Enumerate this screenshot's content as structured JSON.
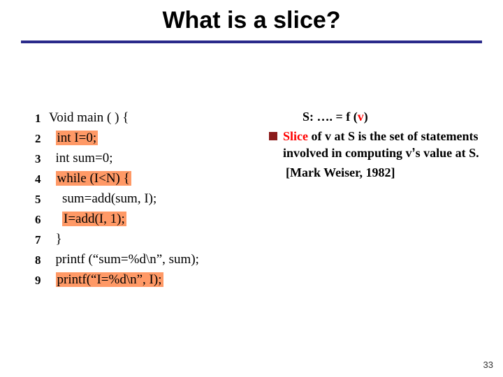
{
  "title": "What is a slice?",
  "code": {
    "lines": [
      {
        "num": "1",
        "indent": 0,
        "text": "Void main ( ) {",
        "hl": false
      },
      {
        "num": "2",
        "indent": 2,
        "text": "int I=0;",
        "hl": true
      },
      {
        "num": "3",
        "indent": 2,
        "text": "int sum=0;",
        "hl": false
      },
      {
        "num": "4",
        "indent": 2,
        "text": "while (I<N) {",
        "hl": true
      },
      {
        "num": "5",
        "indent": 4,
        "text": "sum=add(sum, I);",
        "hl": false
      },
      {
        "num": "6",
        "indent": 4,
        "text": "I=add(I, 1);",
        "hl": true
      },
      {
        "num": "7",
        "indent": 2,
        "text": "}",
        "hl": false
      },
      {
        "num": "8",
        "indent": 2,
        "text": "printf (“sum=%d\\n”, sum);",
        "hl": false
      },
      {
        "num": "9",
        "indent": 2,
        "text": "printf(“I=%d\\n”, I);",
        "hl": true
      }
    ]
  },
  "right": {
    "line1_prefix": "S: …. = f (",
    "line1_var": "v",
    "line1_suffix": ")",
    "line2_word": "Slice",
    "line2_rest_a": " of v at S is  the set of statements involved in computing v",
    "apos": "’",
    "line2_rest_b": "s value at S.",
    "cite": "[Mark Weiser, 1982]"
  },
  "pagenum": "33"
}
